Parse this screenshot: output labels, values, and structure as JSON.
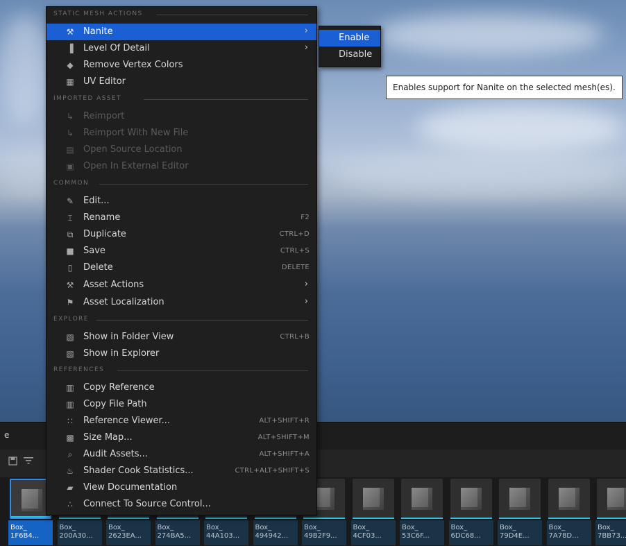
{
  "colors": {
    "menu_bg": "#1f1f1f",
    "highlight": "#1a5fd4",
    "selected_tile": "#1564c4",
    "tile_bar": "#2ec4ea"
  },
  "background": {
    "partial_label": "e"
  },
  "menu": {
    "sections": {
      "static_mesh_actions": "STATIC MESH ACTIONS",
      "imported_asset": "IMPORTED ASSET",
      "common": "COMMON",
      "explore": "EXPLORE",
      "references": "REFERENCES"
    },
    "items": [
      {
        "label": "Nanite",
        "icon": "wrench-icon",
        "submenu": true,
        "highlighted": true
      },
      {
        "label": "Level Of Detail",
        "icon": "lod-icon",
        "submenu": true
      },
      {
        "label": "Remove Vertex Colors",
        "icon": "remove-vertex-colors-icon"
      },
      {
        "label": "UV Editor",
        "icon": "uv-editor-icon"
      },
      {
        "label": "Reimport",
        "icon": "reimport-icon",
        "disabled": true
      },
      {
        "label": "Reimport With New File",
        "icon": "reimport-new-icon",
        "disabled": true
      },
      {
        "label": "Open Source Location",
        "icon": "folder-icon",
        "disabled": true
      },
      {
        "label": "Open In External Editor",
        "icon": "external-editor-icon",
        "disabled": true
      },
      {
        "label": "Edit...",
        "icon": "pencil-icon"
      },
      {
        "label": "Rename",
        "icon": "rename-icon",
        "shortcut": "F2"
      },
      {
        "label": "Duplicate",
        "icon": "duplicate-icon",
        "shortcut": "CTRL+D"
      },
      {
        "label": "Save",
        "icon": "save-icon",
        "shortcut": "CTRL+S"
      },
      {
        "label": "Delete",
        "icon": "trash-icon",
        "shortcut": "DELETE"
      },
      {
        "label": "Asset Actions",
        "icon": "wrench-icon",
        "submenu": true
      },
      {
        "label": "Asset Localization",
        "icon": "flag-icon",
        "submenu": true
      },
      {
        "label": "Show in Folder View",
        "icon": "folder-search-icon",
        "shortcut": "CTRL+B"
      },
      {
        "label": "Show in Explorer",
        "icon": "folder-search-icon"
      },
      {
        "label": "Copy Reference",
        "icon": "copy-reference-icon"
      },
      {
        "label": "Copy File Path",
        "icon": "copy-path-icon"
      },
      {
        "label": "Reference Viewer...",
        "icon": "reference-viewer-icon",
        "shortcut": "ALT+SHIFT+R"
      },
      {
        "label": "Size Map...",
        "icon": "size-map-icon",
        "shortcut": "ALT+SHIFT+M"
      },
      {
        "label": "Audit Assets...",
        "icon": "audit-icon",
        "shortcut": "ALT+SHIFT+A"
      },
      {
        "label": "Shader Cook Statistics...",
        "icon": "shader-icon",
        "shortcut": "CTRL+ALT+SHIFT+S"
      },
      {
        "label": "View Documentation",
        "icon": "documentation-icon"
      },
      {
        "label": "Connect To Source Control...",
        "icon": "source-control-icon"
      }
    ]
  },
  "submenu": {
    "items": [
      {
        "label": "Enable",
        "highlighted": true
      },
      {
        "label": "Disable"
      }
    ]
  },
  "tooltip": {
    "text": "Enables support for Nanite on the selected mesh(es)."
  },
  "assets": {
    "tiles": [
      {
        "line1": "Box_",
        "line2": "1F6B4...",
        "selected": true
      },
      {
        "line1": "Box_",
        "line2": "200A30..."
      },
      {
        "line1": "Box_",
        "line2": "2623EA..."
      },
      {
        "line1": "Box_",
        "line2": "274BA5..."
      },
      {
        "line1": "Box_",
        "line2": "44A103..."
      },
      {
        "line1": "Box_",
        "line2": "494942..."
      },
      {
        "line1": "Box_",
        "line2": "49B2F9..."
      },
      {
        "line1": "Box_",
        "line2": "4CF03..."
      },
      {
        "line1": "Box_",
        "line2": "53C6F..."
      },
      {
        "line1": "Box_",
        "line2": "6DC68..."
      },
      {
        "line1": "Box_",
        "line2": "79D4E..."
      },
      {
        "line1": "Box_",
        "line2": "7A78D..."
      },
      {
        "line1": "Box_",
        "line2": "7BB73..."
      }
    ]
  }
}
